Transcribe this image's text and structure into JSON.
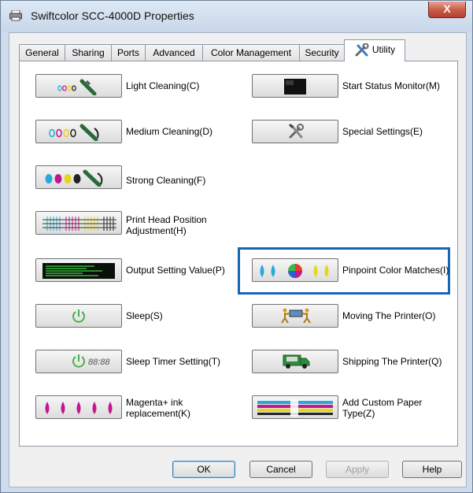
{
  "window": {
    "title": "Swiftcolor SCC-4000D Properties",
    "close_label": "X"
  },
  "tabs": [
    {
      "label": "General"
    },
    {
      "label": "Sharing"
    },
    {
      "label": "Ports"
    },
    {
      "label": "Advanced"
    },
    {
      "label": "Color Management"
    },
    {
      "label": "Security"
    },
    {
      "label": "Utility",
      "active": true
    }
  ],
  "utility": {
    "left": [
      {
        "label": "Light Cleaning(C)"
      },
      {
        "label": "Medium Cleaning(D)"
      },
      {
        "label": "Strong Cleaning(F)"
      },
      {
        "label_line1": "Print Head Position",
        "label_line2": "Adjustment(H)"
      },
      {
        "label": "Output Setting Value(P)"
      },
      {
        "label": "Sleep(S)"
      },
      {
        "label": "Sleep Timer Setting(T)",
        "timer_text": "88:88"
      },
      {
        "label_line1": "Magenta+ ink",
        "label_line2": "replacement(K)"
      }
    ],
    "right": [
      {
        "label": "Start Status Monitor(M)"
      },
      {
        "label": "Special Settings(E)"
      },
      {
        "label": "Pinpoint Color Matches(I)",
        "highlighted": true
      },
      {
        "label": "Moving The Printer(O)"
      },
      {
        "label": "Shipping The Printer(Q)"
      },
      {
        "label_line1": "Add Custom Paper",
        "label_line2": "Type(Z)"
      }
    ]
  },
  "buttons": {
    "ok": "OK",
    "cancel": "Cancel",
    "apply": "Apply",
    "help": "Help"
  },
  "colors": {
    "highlight": "#1565b8",
    "cyan": "#29a9d8",
    "magenta": "#c2188f",
    "yellow": "#e8d41c",
    "black": "#222222",
    "close_red": "#c75a45"
  },
  "icons": {
    "window": "printer-icon",
    "utility_tab": "tools-icon"
  }
}
